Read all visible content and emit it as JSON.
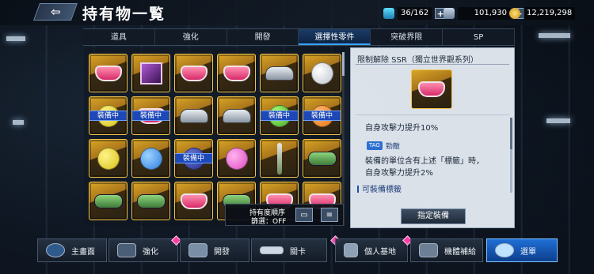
{
  "header": {
    "back_icon": "back-arrow-icon",
    "title": "持有物一覧",
    "resources": [
      {
        "icon": "energy-icon",
        "value": "36/162"
      },
      {
        "icon": "capital-icon",
        "value": "101,930"
      },
      {
        "icon": "coin-icon",
        "value": "12,219,298"
      }
    ]
  },
  "tabs": [
    {
      "label": "道具",
      "active": false
    },
    {
      "label": "強化",
      "active": false
    },
    {
      "label": "開發",
      "active": false
    },
    {
      "label": "選擇性零件",
      "active": true
    },
    {
      "label": "突破界限",
      "active": false
    },
    {
      "label": "SP",
      "active": false
    }
  ],
  "grid": {
    "equipped_label": "裝備中",
    "items": [
      {
        "kind": "pink-part",
        "equipped": false
      },
      {
        "kind": "purple-box",
        "equipped": false
      },
      {
        "kind": "pink-part",
        "equipped": false
      },
      {
        "kind": "pink-part",
        "equipped": false
      },
      {
        "kind": "grey-part",
        "equipped": false
      },
      {
        "kind": "white-ball",
        "equipped": false
      },
      {
        "kind": "yellow-ball",
        "equipped": true
      },
      {
        "kind": "pink-part",
        "equipped": true
      },
      {
        "kind": "grey-part",
        "equipped": false
      },
      {
        "kind": "grey-part",
        "equipped": false
      },
      {
        "kind": "green-ball",
        "equipped": true
      },
      {
        "kind": "orange-ball",
        "equipped": true
      },
      {
        "kind": "yellow-ball",
        "equipped": false
      },
      {
        "kind": "blue-ball",
        "equipped": false
      },
      {
        "kind": "navy-ball",
        "equipped": true
      },
      {
        "kind": "pink-ball",
        "equipped": false
      },
      {
        "kind": "rod",
        "equipped": false
      },
      {
        "kind": "green-part",
        "equipped": false
      },
      {
        "kind": "green-part",
        "equipped": false
      },
      {
        "kind": "green-part",
        "equipped": false
      },
      {
        "kind": "pink-part",
        "equipped": false
      },
      {
        "kind": "green-part",
        "equipped": false
      },
      {
        "kind": "pink-part",
        "equipped": false
      },
      {
        "kind": "pink-part",
        "equipped": false
      }
    ]
  },
  "sort": {
    "line1": "持有度順序",
    "line2": "篩選：OFF",
    "view_icon": "display-toggle-icon",
    "sort_icon": "sort-icon"
  },
  "detail": {
    "title": "限制解除 SSR（獨立世界觀系列）",
    "effect1": "自身攻擊力提升10%",
    "tag_chip": "TAG",
    "tag_name": "勁敵",
    "effect2": "裝備的單位含有上述「標籤」時，",
    "effect3": "自身攻擊力提升2%",
    "equippable_label": "可裝備標籤",
    "assign_button": "指定裝備"
  },
  "bottom_nav": [
    {
      "label": "主畫面",
      "icon": "home-icon",
      "badge": false
    },
    {
      "label": "強化",
      "icon": "upgrade-icon",
      "badge": true
    },
    {
      "label": "開發",
      "icon": "develop-icon",
      "badge": false
    },
    {
      "label": "關卡",
      "icon": "stage-icon",
      "badge": true
    },
    {
      "label": "個人基地",
      "icon": "base-icon",
      "badge": true
    },
    {
      "label": "機體補給",
      "icon": "supply-icon",
      "badge": false
    },
    {
      "label": "選單",
      "icon": "menu-icon",
      "badge": false
    }
  ]
}
